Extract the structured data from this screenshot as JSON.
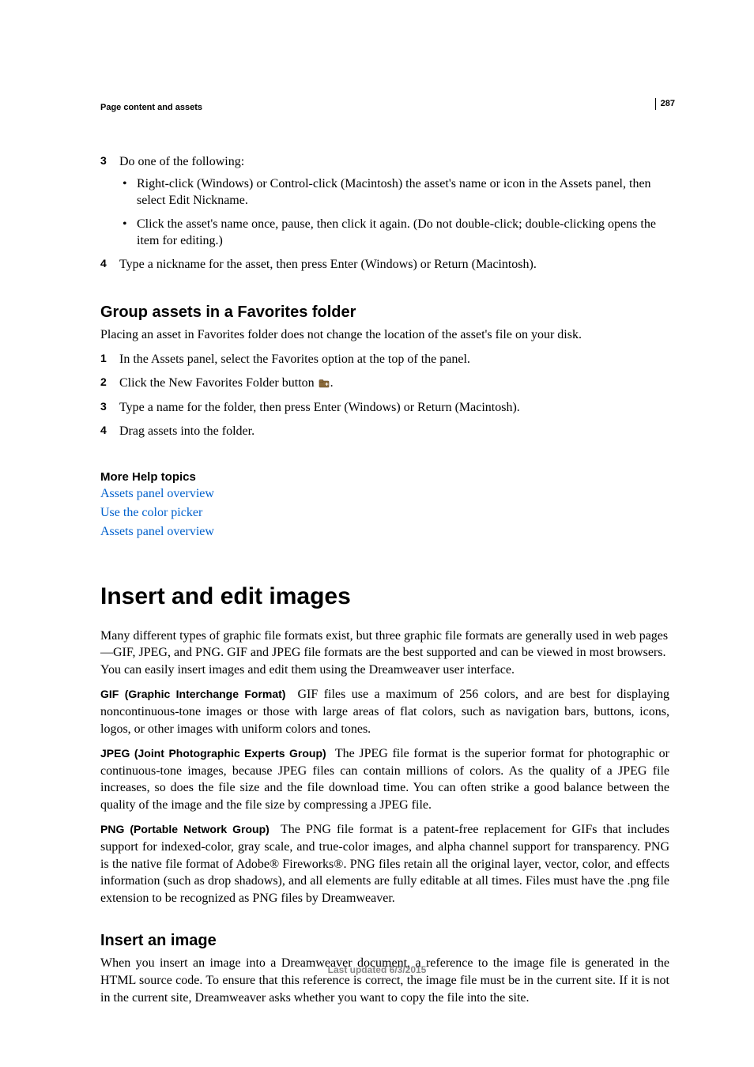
{
  "page_number": "287",
  "running_head": "Page content and assets",
  "step3": {
    "num": "3",
    "text": "Do one of the following:",
    "bullets": [
      "Right-click (Windows) or Control-click (Macintosh) the asset's name or icon in the Assets panel, then select Edit Nickname.",
      "Click the asset's name once, pause, then click it again. (Do not double-click; double-clicking opens the item for editing.)"
    ]
  },
  "step4": {
    "num": "4",
    "text": "Type a nickname for the asset, then press Enter (Windows) or Return (Macintosh)."
  },
  "group_section": {
    "title": "Group assets in a Favorites folder",
    "intro": "Placing an asset in Favorites folder does not change the location of the asset's file on your disk.",
    "steps": [
      {
        "num": "1",
        "text": "In the Assets panel, select the Favorites option at the top of the panel."
      },
      {
        "num": "2",
        "text_before": "Click the New Favorites Folder button ",
        "text_after": "."
      },
      {
        "num": "3",
        "text": "Type a name for the folder, then press Enter (Windows) or Return (Macintosh)."
      },
      {
        "num": "4",
        "text": "Drag assets into the folder."
      }
    ]
  },
  "more_help": {
    "title": "More Help topics",
    "links": [
      "Assets panel overview",
      "Use the color picker",
      "Assets panel overview"
    ]
  },
  "chapter": {
    "title": "Insert and edit images",
    "intro": "Many different types of graphic file formats exist, but three graphic file formats are generally used in web pages—GIF, JPEG, and PNG. GIF and JPEG file formats are the best supported and can be viewed in most browsers. You can easily insert images and edit them using the Dreamweaver user interface.",
    "gif": {
      "label": "GIF (Graphic Interchange Format)",
      "text": "GIF files use a maximum of 256 colors, and are best for displaying noncontinuous-tone images or those with large areas of flat colors, such as navigation bars, buttons, icons, logos, or other images with uniform colors and tones."
    },
    "jpeg": {
      "label": "JPEG (Joint Photographic Experts Group)",
      "text": "The JPEG file format is the superior format for photographic or continuous-tone images, because JPEG files can contain millions of colors. As the quality of a JPEG file increases, so does the file size and the file download time. You can often strike a good balance between the quality of the image and the file size by compressing a JPEG file."
    },
    "png": {
      "label": "PNG (Portable Network Group)",
      "text": "The PNG file format is a patent-free replacement for GIFs that includes support for indexed-color, gray scale, and true-color images, and alpha channel support for transparency. PNG is the native file format of Adobe® Fireworks®. PNG files retain all the original layer, vector, color, and effects information (such as drop shadows), and all elements are fully editable at all times. Files must have the .png file extension to be recognized as PNG files by Dreamweaver."
    }
  },
  "insert_section": {
    "title": "Insert an image",
    "text": "When you insert an image into a Dreamweaver document, a reference to the image file is generated in the HTML source code. To ensure that this reference is correct, the image file must be in the current site. If it is not in the current site, Dreamweaver asks whether you want to copy the file into the site."
  },
  "footer": "Last updated 6/3/2015"
}
